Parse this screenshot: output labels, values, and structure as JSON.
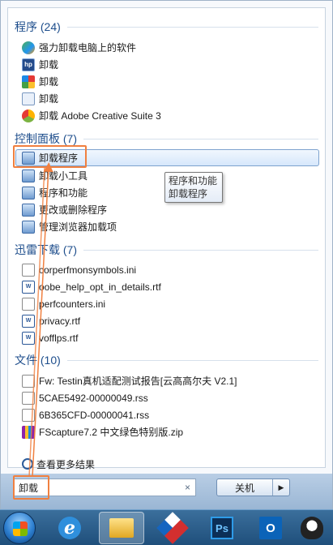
{
  "groups": [
    {
      "header": "程序 (24)",
      "items": [
        {
          "label": "强力卸载电脑上的软件",
          "icon": "shield-program-icon"
        },
        {
          "label": "卸载",
          "icon": "hp-uninstall-icon"
        },
        {
          "label": "卸载",
          "icon": "colorful-uninstall-icon"
        },
        {
          "label": "卸载",
          "icon": "calendar-uninstall-icon"
        },
        {
          "label": "卸载 Adobe Creative Suite 3",
          "icon": "adobe-icon"
        }
      ]
    },
    {
      "header": "控制面板 (7)",
      "items": [
        {
          "label": "卸载程序",
          "icon": "control-panel-icon"
        },
        {
          "label": "卸载小工具",
          "icon": "control-panel-icon"
        },
        {
          "label": "程序和功能",
          "icon": "control-panel-icon"
        },
        {
          "label": "更改或删除程序",
          "icon": "control-panel-icon"
        },
        {
          "label": "管理浏览器加载项",
          "icon": "control-panel-icon"
        }
      ]
    },
    {
      "header": "迅雷下载 (7)",
      "items": [
        {
          "label": "corperfmonsymbols.ini",
          "icon": "ini-file-icon"
        },
        {
          "label": "oobe_help_opt_in_details.rtf",
          "icon": "rtf-file-icon"
        },
        {
          "label": "perfcounters.ini",
          "icon": "ini-file-icon"
        },
        {
          "label": "privacy.rtf",
          "icon": "rtf-file-icon"
        },
        {
          "label": "vofflps.rtf",
          "icon": "rtf-file-icon"
        }
      ]
    },
    {
      "header": "文件 (10)",
      "items": [
        {
          "label": "Fw: Testin真机适配测试报告[云高高尔夫 V2.1]",
          "icon": "document-icon"
        },
        {
          "label": "5CAE5492-00000049.rss",
          "icon": "document-icon"
        },
        {
          "label": "6B365CFD-00000041.rss",
          "icon": "document-icon"
        },
        {
          "label": "FScapture7.2 中文绿色特别版.zip",
          "icon": "zip-archive-icon"
        }
      ]
    }
  ],
  "more_results": "查看更多结果",
  "tooltip": {
    "line1": "程序和功能",
    "line2": "卸载程序"
  },
  "search": {
    "value": "卸载",
    "clear": "×"
  },
  "shutdown": {
    "label": "关机",
    "arrow": "▶"
  },
  "taskbar": {
    "apps": [
      "internet-explorer",
      "file-explorer",
      "red-app",
      "photoshop",
      "outlook",
      "qq"
    ],
    "ps_label": "Ps",
    "outlook_label": "O"
  },
  "colors": {
    "header": "#1e4e8c",
    "annotation": "#f08040",
    "selection": "#d6e7fb"
  }
}
